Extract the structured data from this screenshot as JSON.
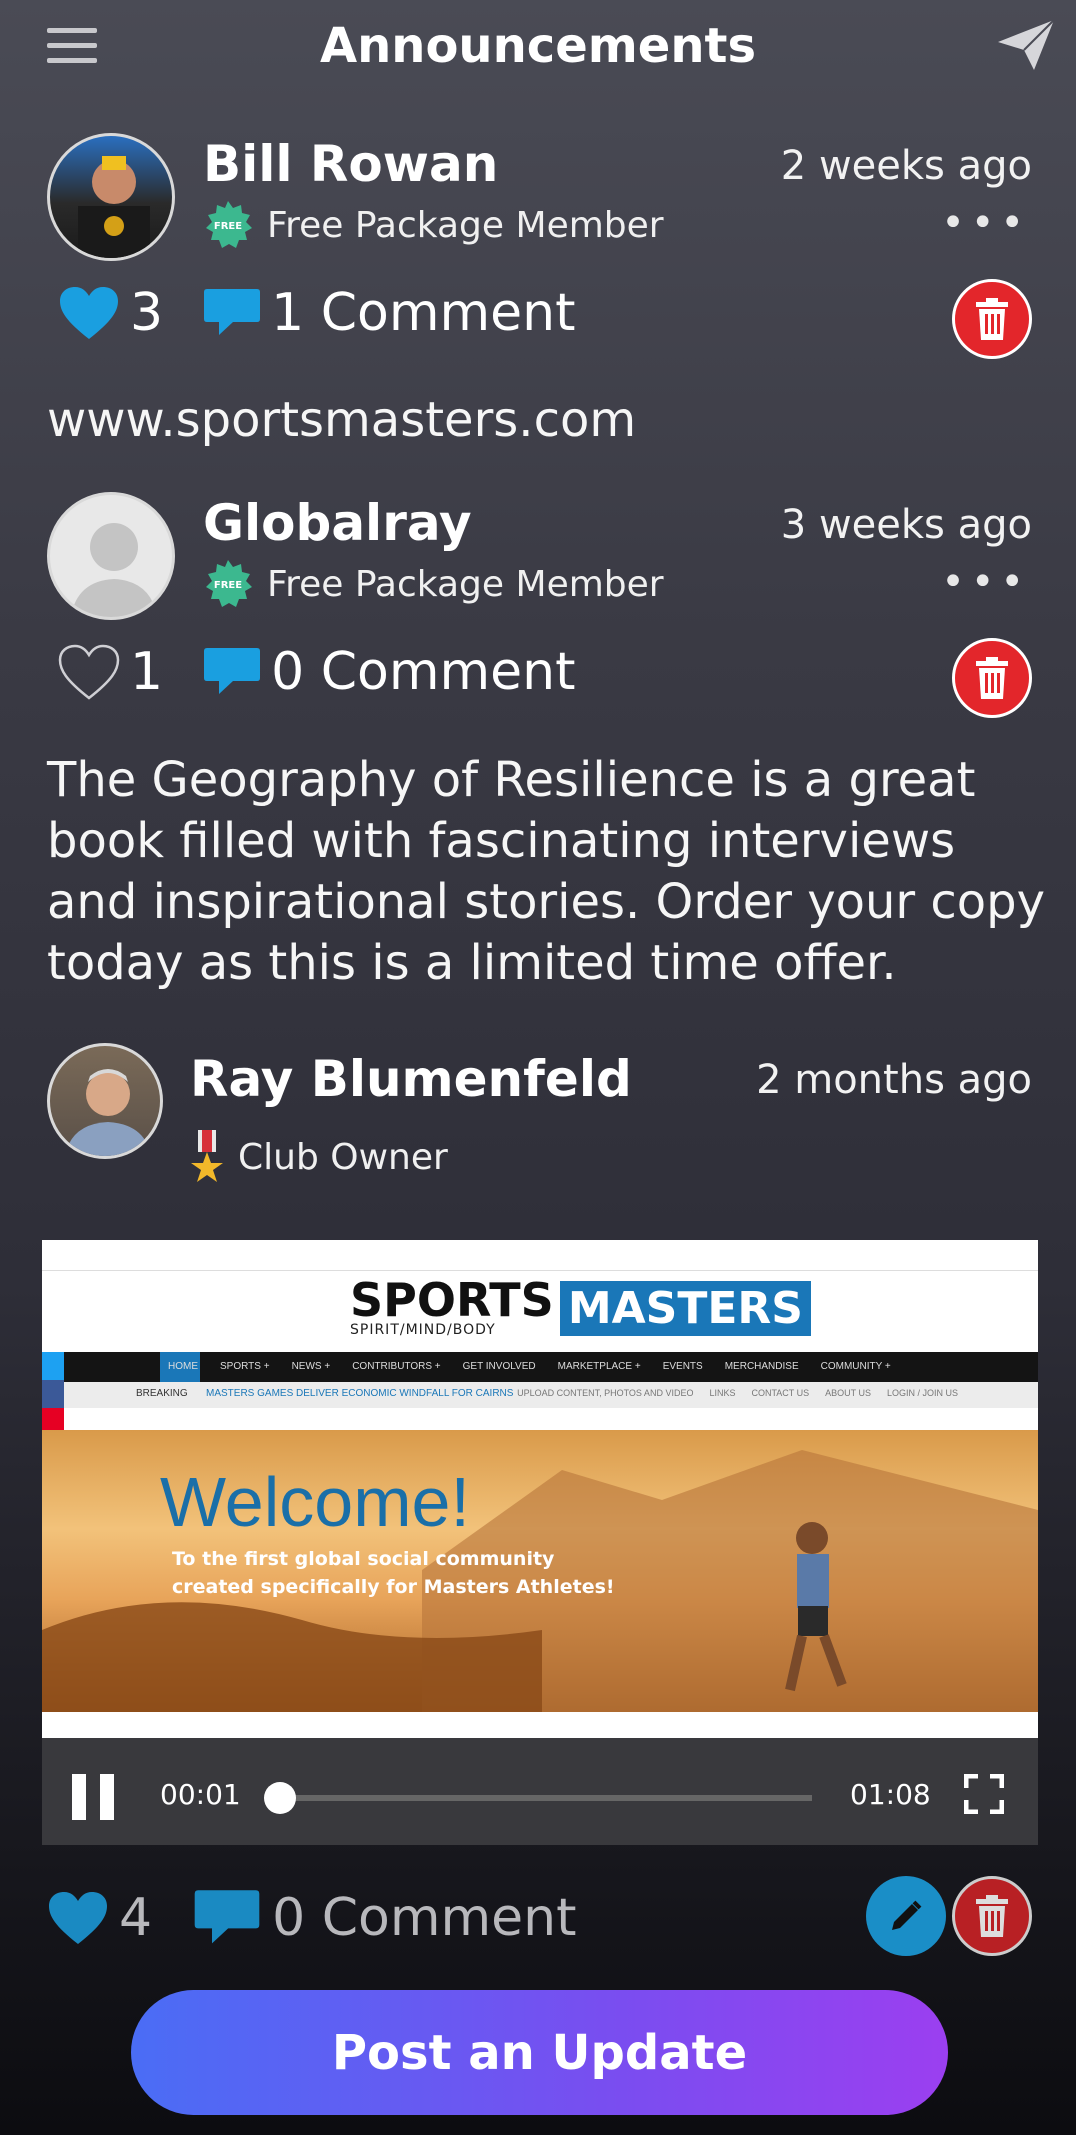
{
  "header": {
    "title": "Announcements"
  },
  "posts": [
    {
      "name": "Bill Rowan",
      "time": "2 weeks ago",
      "badge_icon_text": "FREE",
      "membership": "Free Package Member",
      "likes": "3",
      "comments": "1 Comment",
      "text": "www.sportsmasters.com"
    },
    {
      "name": "Globalray",
      "time": "3 weeks ago",
      "badge_icon_text": "FREE",
      "membership": "Free Package Member",
      "likes": "1",
      "comments": "0 Comment",
      "text": "The Geography of Resilience is a great book filled with fascinating interviews and inspirational stories. Order your copy today as this is a limited time offer."
    },
    {
      "name": "Ray Blumenfeld",
      "time": "2 months ago",
      "membership": "Club Owner",
      "likes": "4",
      "comments": "0 Comment"
    }
  ],
  "video": {
    "logo_sports": "SPORTS",
    "logo_tagline": "SPIRIT/MIND/BODY",
    "logo_masters": "MASTERS",
    "nav": [
      "HOME",
      "SPORTS +",
      "NEWS +",
      "CONTRIBUTORS +",
      "GET INVOLVED",
      "MARKETPLACE +",
      "EVENTS",
      "MERCHANDISE",
      "COMMUNITY +"
    ],
    "breaking_label": "BREAKING",
    "breaking_text": "MASTERS GAMES DELIVER ECONOMIC WINDFALL FOR CAIRNS",
    "sub_links": [
      "UPLOAD CONTENT, PHOTOS AND VIDEO",
      "LINKS",
      "CONTACT US",
      "ABOUT US",
      "LOGIN / JOIN US"
    ],
    "welcome": "Welcome!",
    "welcome_sub": "To the first global social community created specifically for Masters Athletes!",
    "current_time": "00:01",
    "duration": "01:08",
    "progress": 0.015
  },
  "post_button": "Post an Update",
  "colors": {
    "like_blue": "#1a9fe0",
    "delete_red": "#e3262b",
    "free_green": "#3cb88f"
  }
}
